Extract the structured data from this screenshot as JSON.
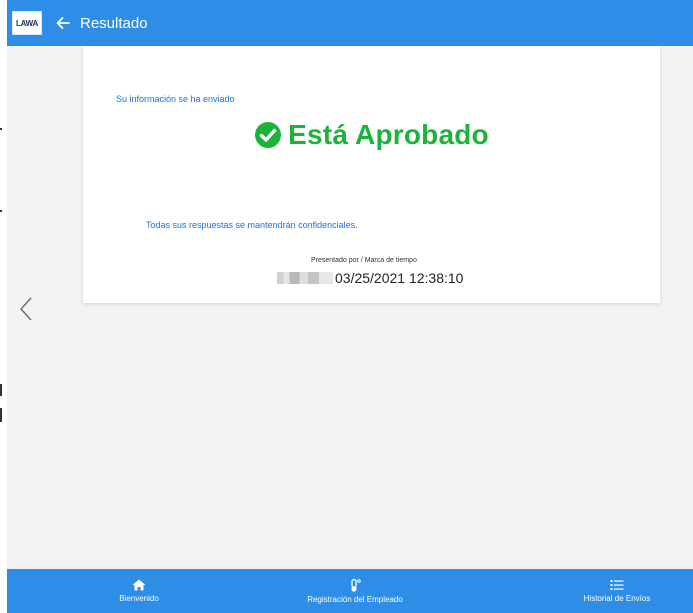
{
  "header": {
    "logo_text": "LAWA",
    "title": "Resultado",
    "back_icon": "arrow-left-icon"
  },
  "result": {
    "sent_message": "Su información se ha enviado",
    "status_text": "Está Aprobado",
    "status_icon": "check-circle-icon",
    "confidential_message": "Todas sus respuestas se mantendrán confidenciales.",
    "presented_label": "Presentado por / Marca de tiempo",
    "timestamp": "03/25/2021 12:38:10"
  },
  "nav": {
    "prev_icon": "chevron-left-icon"
  },
  "bottom_nav": {
    "items": [
      {
        "label": "Bienvenido",
        "icon": "home-icon"
      },
      {
        "label": "Registración del Empleado",
        "icon": "thermometer-icon"
      },
      {
        "label": "Historial de Envíos",
        "icon": "list-icon"
      }
    ]
  },
  "colors": {
    "primary": "#2e8de6",
    "success": "#1db33b",
    "link": "#1a73d9"
  }
}
